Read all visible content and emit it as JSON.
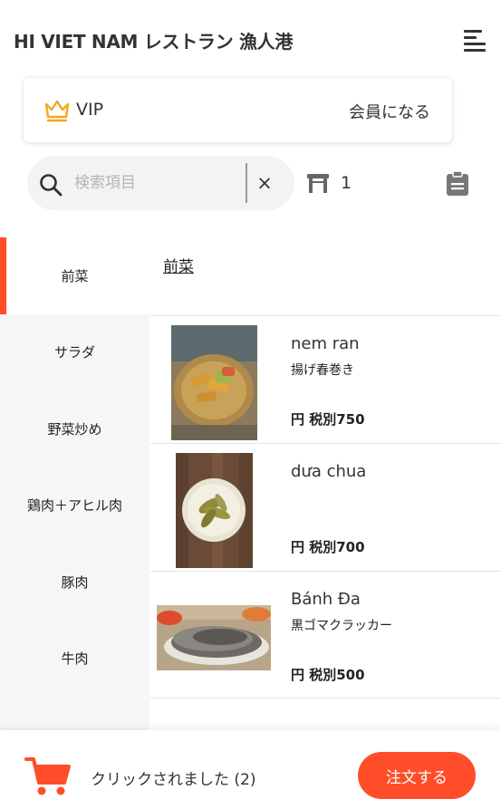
{
  "header": {
    "title": "HI VIET NAM レストラン 漁人港",
    "menu_icon": "hamburger-menu-icon"
  },
  "vip": {
    "label": "VIP",
    "action": "会員になる",
    "icon": "crown-icon",
    "accent": "#f2a81d"
  },
  "search": {
    "placeholder": "検索項目",
    "value": "",
    "clear_label": "×"
  },
  "table": {
    "number": "1",
    "icon": "table-icon"
  },
  "clipboard_icon": "clipboard-icon",
  "categories": [
    {
      "label": "前菜",
      "active": true
    },
    {
      "label": "サラダ",
      "active": false
    },
    {
      "label": "野菜炒め",
      "active": false
    },
    {
      "label": "鶏肉＋アヒル肉",
      "active": false
    },
    {
      "label": "豚肉",
      "active": false
    },
    {
      "label": "牛肉",
      "active": false
    }
  ],
  "section": {
    "title": "前菜"
  },
  "dishes": [
    {
      "name": "nem ran",
      "subtitle": "揚げ春巻き",
      "price": "円 税別750",
      "image": "fried-spring-rolls-photo"
    },
    {
      "name": "dưa chua",
      "subtitle": "",
      "price": "円 税別700",
      "image": "pickled-vegetables-photo"
    },
    {
      "name": "Bánh Đa",
      "subtitle": "黒ゴマクラッカー",
      "price": "円 税別500",
      "image": "black-sesame-cracker-photo"
    }
  ],
  "bottom": {
    "cart_text": "クリックされました (2)",
    "order_button": "注文する",
    "cart_icon": "cart-icon"
  },
  "colors": {
    "accent": "#ff4d2a",
    "sidebar_bg": "#f6f6f6",
    "search_bg": "#f3f3f3",
    "crown": "#f2a81d"
  }
}
